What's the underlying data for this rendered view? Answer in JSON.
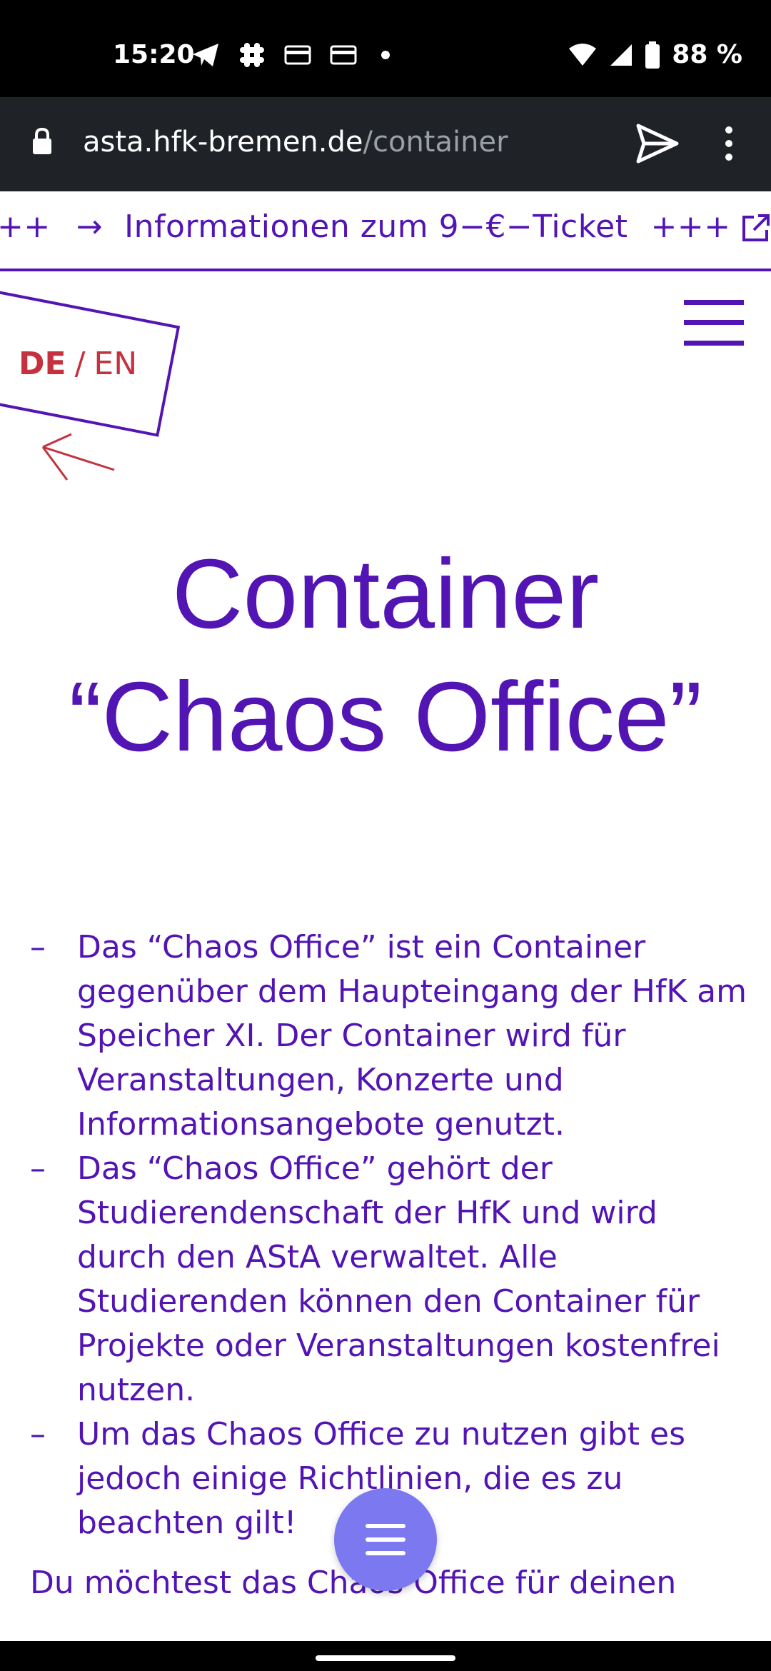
{
  "status_bar": {
    "time": "15:20",
    "battery": "88 %",
    "icons": [
      "telegram-icon",
      "slack-icon",
      "card-icon",
      "card-icon",
      "dot-icon",
      "wifi-icon",
      "signal-icon",
      "battery-icon"
    ]
  },
  "browser": {
    "url_domain": "asta.hfk-bremen.de",
    "url_path": "/container"
  },
  "ticker": {
    "prefix": "++",
    "text": "Informationen zum 9−€−Ticket",
    "suffix": "+++"
  },
  "language": {
    "de": "DE",
    "separator": "/",
    "en": "EN"
  },
  "page": {
    "title_line1": "Container",
    "title_line2": "“Chaos Office”",
    "bullets": [
      "Das “Chaos Office” ist ein Container gegenüber dem Haupteingang der HfK am Speicher XI. Der Container wird für Veranstaltungen, Konzerte und Informationsangebote genutzt.",
      "Das “Chaos Office” gehört der Studierendenschaft der HfK und wird durch den AStA verwaltet. Alle Studierenden können den Container für Projekte oder Veranstaltungen kostenfrei nutzen.",
      "Um das Chaos Office zu nutzen gibt es jedoch einige Richtlinien, die es zu beachten gilt!"
    ],
    "dash": "–",
    "trailing_paragraph": "Du möchtest das Chaos Office für deinen"
  },
  "colors": {
    "accent": "#5314b4",
    "red": "#c4323f",
    "fab": "#7b78f0"
  }
}
